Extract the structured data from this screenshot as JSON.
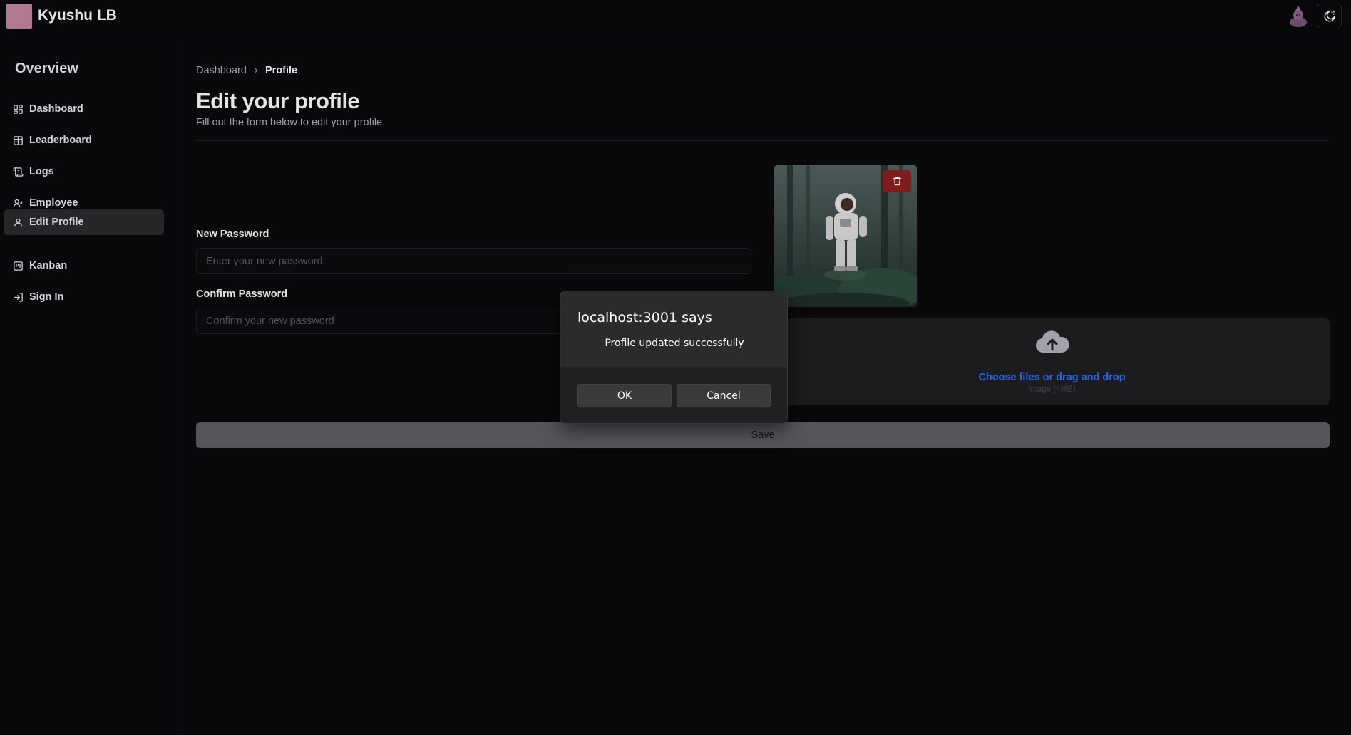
{
  "header": {
    "app_title": "Kyushu LB",
    "logo_color": "#b07a92"
  },
  "sidebar": {
    "title": "Overview",
    "items": [
      {
        "label": "Dashboard",
        "icon": "dashboard-icon"
      },
      {
        "label": "Leaderboard",
        "icon": "table-icon"
      },
      {
        "label": "Logs",
        "icon": "scroll-icon"
      },
      {
        "label": "Employee",
        "icon": "user-x-icon"
      },
      {
        "label": "Edit Profile",
        "icon": "user-icon",
        "active": true
      },
      {
        "label": "Kanban",
        "icon": "kanban-icon"
      },
      {
        "label": "Sign In",
        "icon": "sign-in-icon"
      }
    ]
  },
  "breadcrumb": {
    "parent": "Dashboard",
    "current": "Profile"
  },
  "page": {
    "title": "Edit your profile",
    "subtitle": "Fill out the form below to edit your profile."
  },
  "form": {
    "new_password_label": "New Password",
    "new_password_placeholder": "Enter your new password",
    "new_password_value": "",
    "confirm_password_label": "Confirm Password",
    "confirm_password_placeholder": "Confirm your new password",
    "confirm_password_value": "",
    "save_label": "Save"
  },
  "upload": {
    "label": "Choose files or drag and drop",
    "hint": "Image (4MB)",
    "accent_color": "#2563eb"
  },
  "dialog": {
    "title": "localhost:3001 says",
    "message": "Profile updated successfully",
    "ok_label": "OK",
    "cancel_label": "Cancel"
  }
}
